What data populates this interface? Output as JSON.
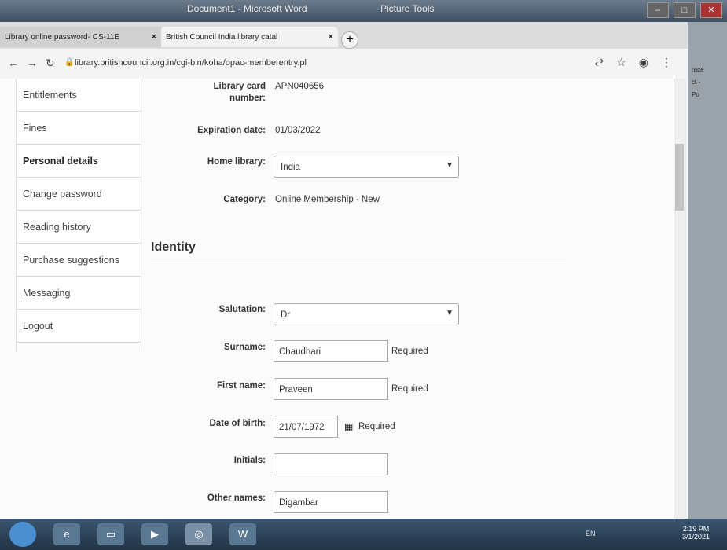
{
  "os_window": {
    "word_title": "Document1 - Microsoft Word",
    "picture_tools": "Picture Tools"
  },
  "browser": {
    "tabs": [
      {
        "label": "Library online password- CS-11E"
      },
      {
        "label": "British Council India library catal"
      }
    ],
    "url": "library.britishcouncil.org.in/cgi-bin/koha/opac-memberentry.pl"
  },
  "sidebar": {
    "items": [
      {
        "label": "Entitlements"
      },
      {
        "label": "Fines"
      },
      {
        "label": "Personal details"
      },
      {
        "label": "Change password"
      },
      {
        "label": "Reading history"
      },
      {
        "label": "Purchase suggestions"
      },
      {
        "label": "Messaging"
      },
      {
        "label": "Logout"
      }
    ]
  },
  "library": {
    "card_label": "Library card",
    "card_label_2": "number:",
    "card_value": "APN040656",
    "expiration_label": "Expiration date:",
    "expiration_value": "01/03/2022",
    "home_library_label": "Home library:",
    "home_library_value": "India",
    "category_label": "Category:",
    "category_value": "Online Membership - New"
  },
  "identity": {
    "heading": "Identity",
    "salutation_label": "Salutation:",
    "salutation_value": "Dr",
    "surname_label": "Surname:",
    "surname_value": "Chaudhari",
    "firstname_label": "First name:",
    "firstname_value": "Praveen",
    "dob_label": "Date of birth:",
    "dob_value": "21/07/1972",
    "initials_label": "Initials:",
    "initials_value": "",
    "othernames_label": "Other names:",
    "othernames_value": "Digambar",
    "required": "Required"
  },
  "right_strip": [
    "race",
    "ct -",
    "Po"
  ],
  "taskbar": {
    "lang": "EN",
    "time": "2:19 PM",
    "date": "3/1/2021"
  }
}
